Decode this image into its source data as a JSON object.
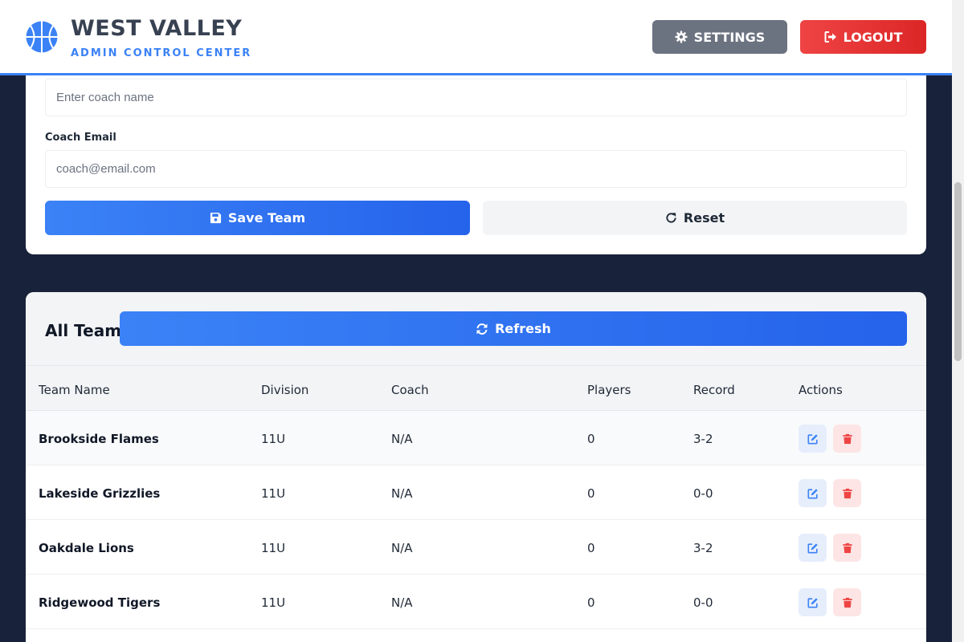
{
  "brand": {
    "title": "WEST VALLEY",
    "subtitle": "ADMIN CONTROL CENTER",
    "logo_icon": "basketball-icon"
  },
  "header": {
    "settings_label": "SETTINGS",
    "settings_icon": "gear-icon",
    "logout_label": "LOGOUT",
    "logout_icon": "sign-out-icon"
  },
  "form": {
    "coach_name_placeholder": "Enter coach name",
    "coach_email_label": "Coach Email",
    "coach_email_placeholder": "coach@email.com",
    "save_label": "Save Team",
    "save_icon": "floppy-disk-icon",
    "reset_label": "Reset",
    "reset_icon": "rotate-icon"
  },
  "teams": {
    "title": "All Teams",
    "refresh_label": "Refresh",
    "refresh_icon": "sync-icon",
    "columns": [
      "Team Name",
      "Division",
      "Coach",
      "Players",
      "Record",
      "Actions"
    ],
    "rows": [
      {
        "name": "Brookside Flames",
        "division": "11U",
        "coach": "N/A",
        "players": "0",
        "record": "3-2"
      },
      {
        "name": "Lakeside Grizzlies",
        "division": "11U",
        "coach": "N/A",
        "players": "0",
        "record": "0-0"
      },
      {
        "name": "Oakdale Lions",
        "division": "11U",
        "coach": "N/A",
        "players": "0",
        "record": "3-2"
      },
      {
        "name": "Ridgewood Tigers",
        "division": "11U",
        "coach": "N/A",
        "players": "0",
        "record": "0-0"
      }
    ]
  },
  "colors": {
    "accent": "#3b82f6",
    "danger": "#ef4444",
    "background": "#18223a"
  }
}
